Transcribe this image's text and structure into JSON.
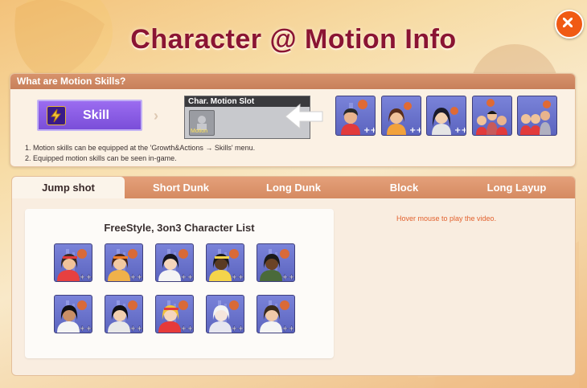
{
  "page": {
    "title": "Character @ Motion Info"
  },
  "colors": {
    "title": "#8a1433",
    "close_button": "#f05a14",
    "skill_box": "#7a4ed9",
    "tab_bar": "#d58a61",
    "hint_text": "#e2612e",
    "card_background": "#5b64bf"
  },
  "motion_skills": {
    "header": "What are Motion Skills?",
    "skill_label": "Skill",
    "slot_header": "Char. Motion Slot",
    "slot_icon_label": "Motion",
    "thumbnails": [
      {
        "hair": "#2a2a2a",
        "skin": "#e9b48d",
        "shirt": "#e23b3b",
        "type": "single"
      },
      {
        "hair": "#5a2e1a",
        "skin": "#f0c39a",
        "shirt": "#f2a23b",
        "type": "single"
      },
      {
        "hair": "#1a1a2a",
        "skin": "#f2d0b0",
        "shirt": "#e5e5e5",
        "type": "single"
      },
      {
        "hair": "#1a1a1a",
        "skin": "#f0c39a",
        "shirt": "#e23b3b",
        "type": "group"
      },
      {
        "hair": "#1a1a1a",
        "skin": "#f0c39a",
        "shirt": "#e23b3b",
        "type": "group"
      }
    ],
    "notes": [
      "1. Motion skills can be equipped at the 'Growth&Actions → Skills' menu.",
      "2. Equipped motion skills can be seen in-game."
    ]
  },
  "tabs": [
    {
      "label": "Jump shot",
      "active": true
    },
    {
      "label": "Short Dunk",
      "active": false
    },
    {
      "label": "Long Dunk",
      "active": false
    },
    {
      "label": "Block",
      "active": false
    },
    {
      "label": "Long Layup",
      "active": false
    }
  ],
  "character_list": {
    "title": "FreeStyle, 3on3 Character List",
    "characters": [
      {
        "hair": "#3a2a22",
        "skin": "#f0c39a",
        "shirt": "#e64040",
        "band": "#e23b3b"
      },
      {
        "hair": "#4a2616",
        "skin": "#f2c9a2",
        "shirt": "#f0b14a",
        "band": "#f07c2a"
      },
      {
        "hair": "#151520",
        "skin": "#f6d6bc",
        "shirt": "#f4f4f4",
        "band": ""
      },
      {
        "hair": "#1a1a1a",
        "skin": "#5a3b22",
        "shirt": "#f4d44b",
        "band": "#f4d44b"
      },
      {
        "hair": "#1a1a1a",
        "skin": "#6b4326",
        "shirt": "#4a6a3a",
        "band": ""
      },
      {
        "hair": "#0f0f15",
        "skin": "#c98f66",
        "shirt": "#f4f4f4",
        "band": ""
      },
      {
        "hair": "#0f0f15",
        "skin": "#f2d0b0",
        "shirt": "#e8e8e8",
        "band": ""
      },
      {
        "hair": "#f2c23a",
        "skin": "#f6d6bc",
        "shirt": "#e63a3a",
        "band": "#e23b3b"
      },
      {
        "hair": "#f4f4f4",
        "skin": "#f6e6dc",
        "shirt": "#e6e6f0",
        "band": ""
      },
      {
        "hair": "#3a2a1a",
        "skin": "#f0c9a8",
        "shirt": "#f4f4f4",
        "band": ""
      }
    ]
  },
  "hint": "Hover mouse to play the video."
}
